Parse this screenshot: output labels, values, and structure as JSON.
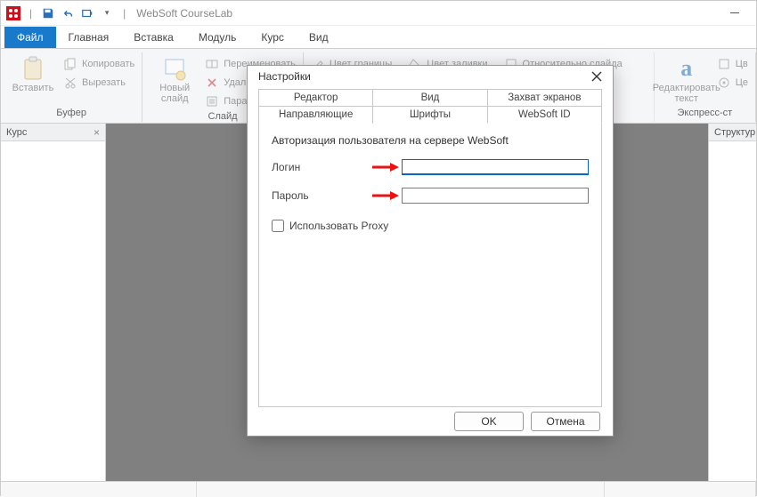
{
  "titlebar": {
    "app_title": "WebSoft CourseLab"
  },
  "ribbon_tabs": {
    "file": "Файл",
    "items": [
      "Главная",
      "Вставка",
      "Модуль",
      "Курс",
      "Вид"
    ]
  },
  "ribbon": {
    "buffer": {
      "group_title": "Буфер",
      "paste": "Вставить",
      "copy": "Копировать",
      "cut": "Вырезать"
    },
    "slide": {
      "group_title": "Слайд",
      "new_slide": "Новый\nслайд",
      "rename": "Переименовать",
      "delete": "Удалить",
      "params": "Параметр"
    },
    "edit": {
      "border_color": "Цвет границы",
      "fill_color": "Цвет заливки",
      "relative_slide": "Относительно слайда"
    },
    "text": {
      "group_title": "Экспресс-ст",
      "edit_text": "Редактировать\nтекст",
      "partial1": "Цв",
      "partial2": "Це"
    }
  },
  "panels": {
    "left_title": "Курс",
    "right_title": "Структур"
  },
  "dialog": {
    "title": "Настройки",
    "tabs_row1": [
      "Редактор",
      "Вид",
      "Захват экранов"
    ],
    "tabs_row2": [
      "Направляющие",
      "Шрифты",
      "WebSoft ID"
    ],
    "active_tab": "WebSoft ID",
    "auth_desc": "Авторизация пользователя на сервере WebSoft",
    "login_label": "Логин",
    "password_label": "Пароль",
    "login_value": "",
    "password_value": "",
    "use_proxy_label": "Использовать Proxy",
    "ok": "OK",
    "cancel": "Отмена"
  }
}
